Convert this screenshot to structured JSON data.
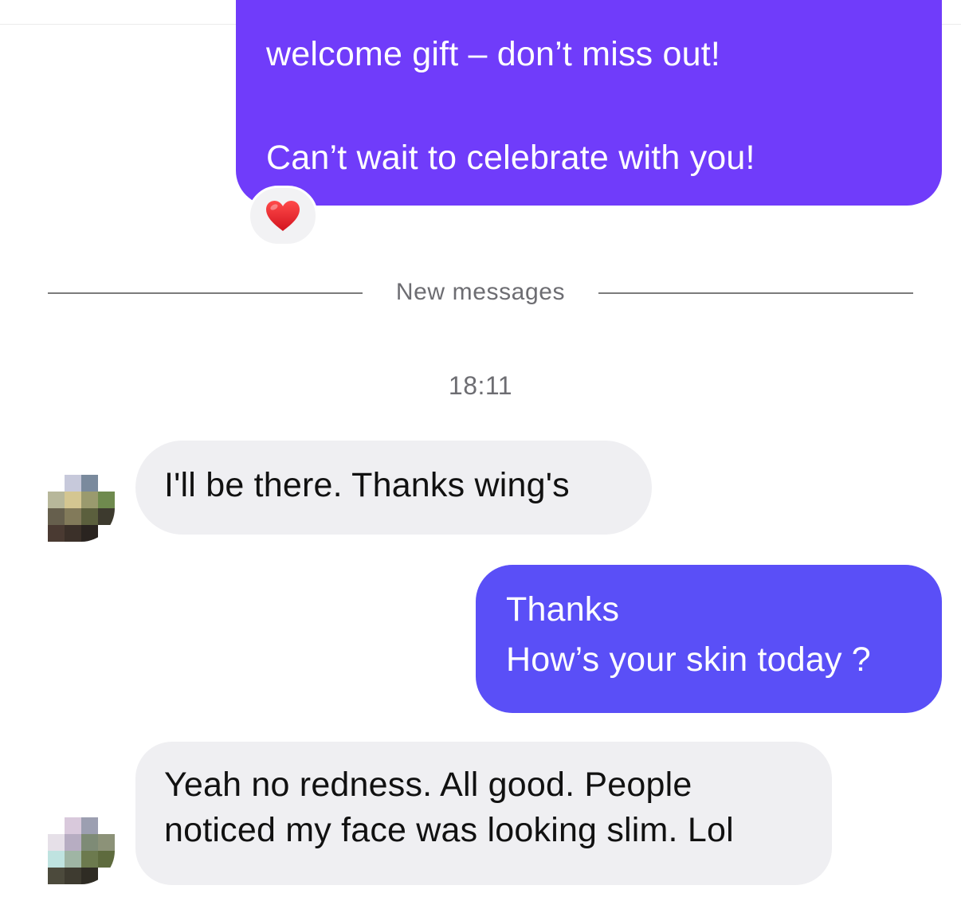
{
  "conversation": {
    "messages": [
      {
        "direction": "outgoing",
        "lines": [
          "welcome gift – don’t miss out!",
          "Can’t wait to celebrate with you!"
        ],
        "reaction": "heart-emoji"
      },
      {
        "direction": "incoming",
        "lines": [
          "I'll be there. Thanks wing's"
        ]
      },
      {
        "direction": "outgoing",
        "lines": [
          "Thanks",
          "How’s your skin today ?"
        ]
      },
      {
        "direction": "incoming",
        "lines": [
          "Yeah no redness. All good. People",
          "noticed my face was looking slim. Lol"
        ]
      }
    ],
    "new_messages_divider": "New messages",
    "timestamp": "18:11"
  },
  "colors": {
    "outgoing_primary": "#703cfa",
    "outgoing_secondary": "#5a4ff7",
    "incoming_bubble": "#efeff2",
    "reaction_heart": "#e8232f"
  },
  "icons": {
    "reaction": "heart-emoji",
    "avatar": "pixelated-avatar"
  }
}
